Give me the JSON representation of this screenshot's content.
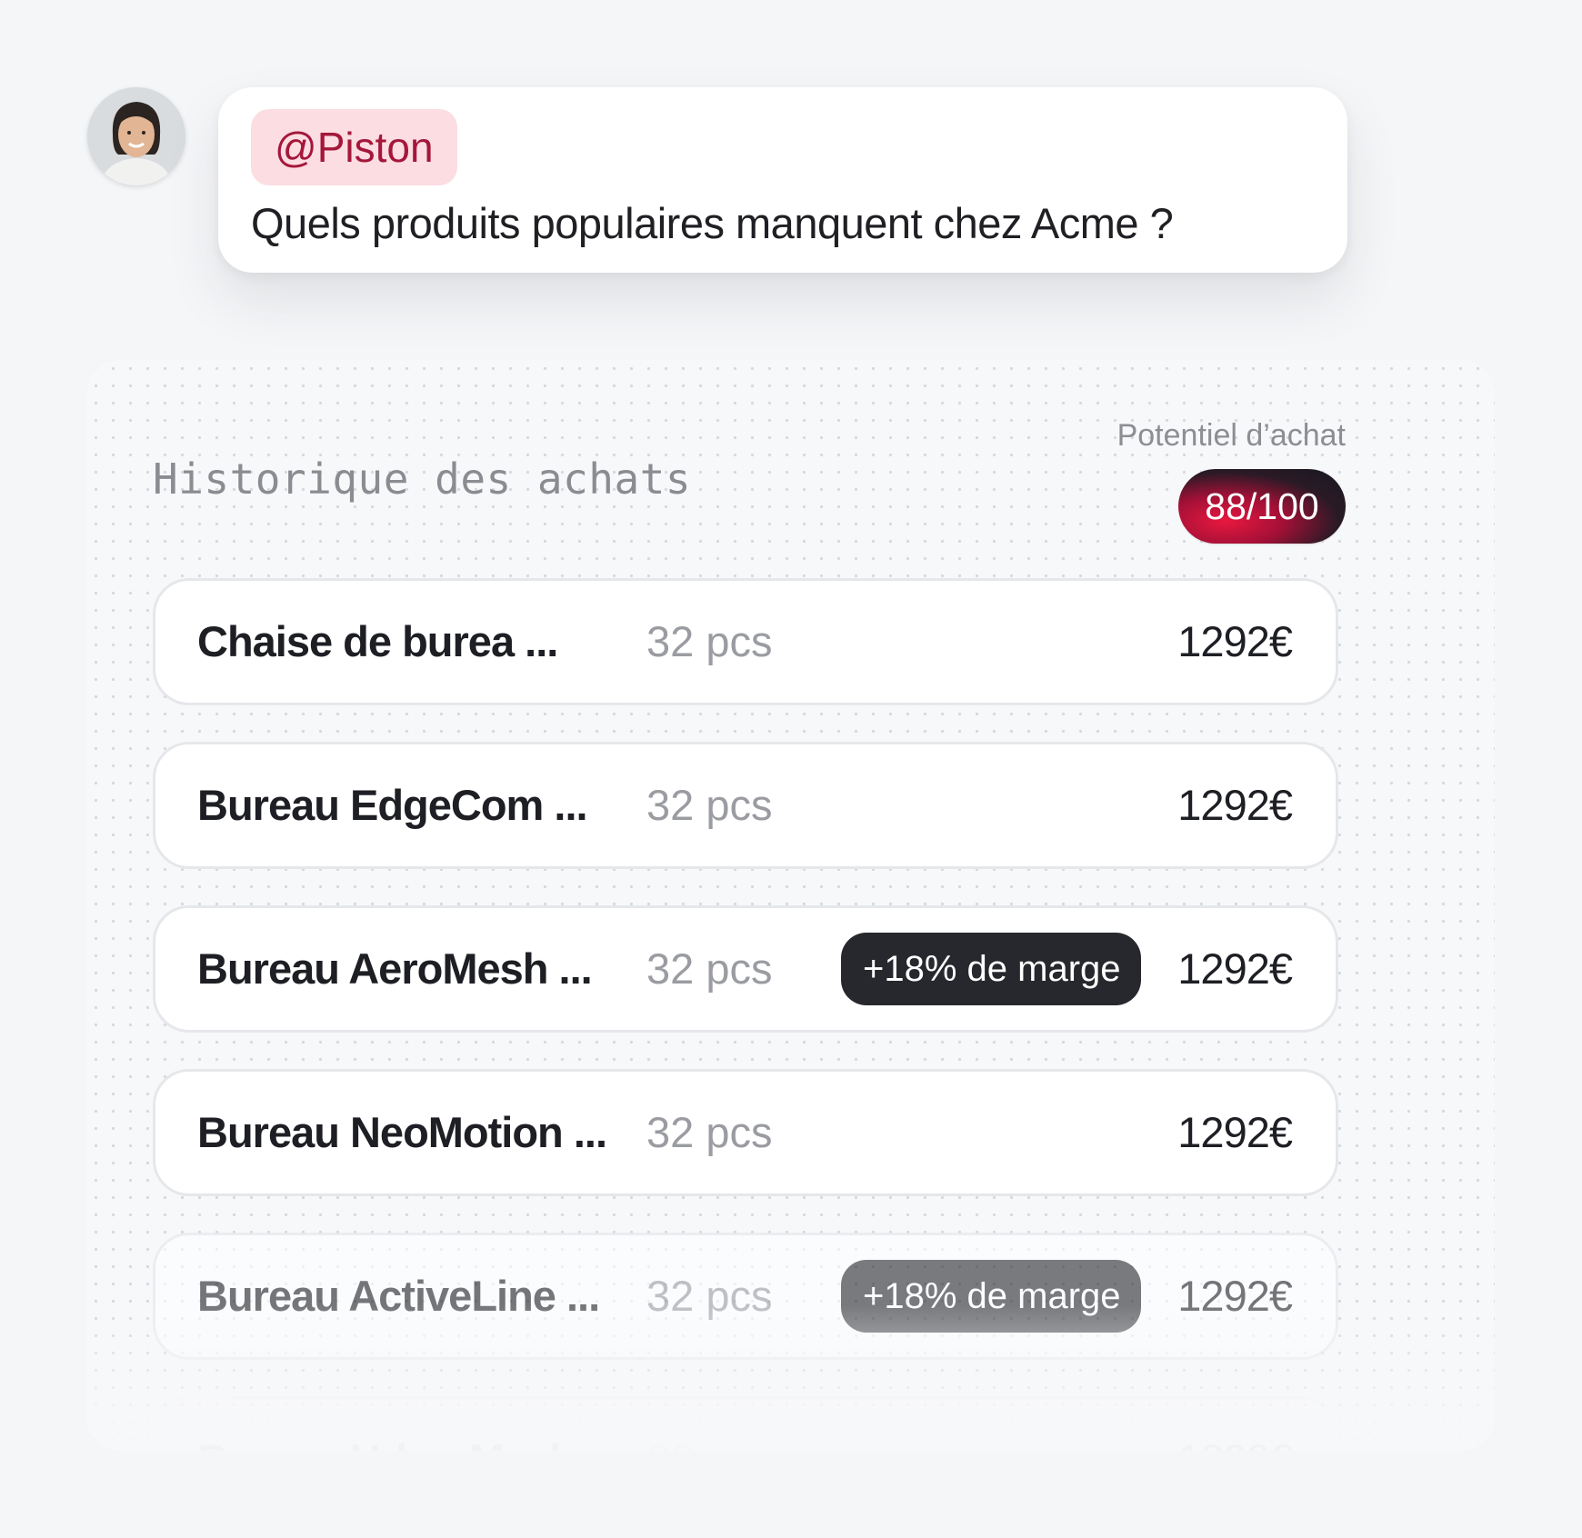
{
  "message": {
    "avatar_icon": "user-avatar-photo",
    "mention": "@Piston",
    "question": "Quels produits populaires manquent chez Acme ?"
  },
  "panel": {
    "title": "Historique des achats",
    "potential_label": "Potentiel d’achat",
    "score": "88/100",
    "rows": [
      {
        "name": "Chaise de burea ...",
        "qty": "32 pcs",
        "badge": "",
        "price": "1292€"
      },
      {
        "name": "Bureau EdgeCom ...",
        "qty": "32 pcs",
        "badge": "",
        "price": "1292€"
      },
      {
        "name": "Bureau AeroMesh ...",
        "qty": "32 pcs",
        "badge": "+18% de marge",
        "price": "1292€"
      },
      {
        "name": "Bureau NeoMotion ...",
        "qty": "32 pcs",
        "badge": "",
        "price": "1292€"
      },
      {
        "name": "Bureau ActiveLine ...",
        "qty": "32 pcs",
        "badge": "+18% de marge",
        "price": "1292€"
      },
      {
        "name": "Bureau UrbanMesh ...",
        "qty": "32 pcs",
        "badge": "",
        "price": "1292€"
      }
    ]
  },
  "colors": {
    "mention_bg": "#fbdde2",
    "mention_text": "#a5173a",
    "badge_dark": "#27282d",
    "score_accent": "#e8183f"
  }
}
